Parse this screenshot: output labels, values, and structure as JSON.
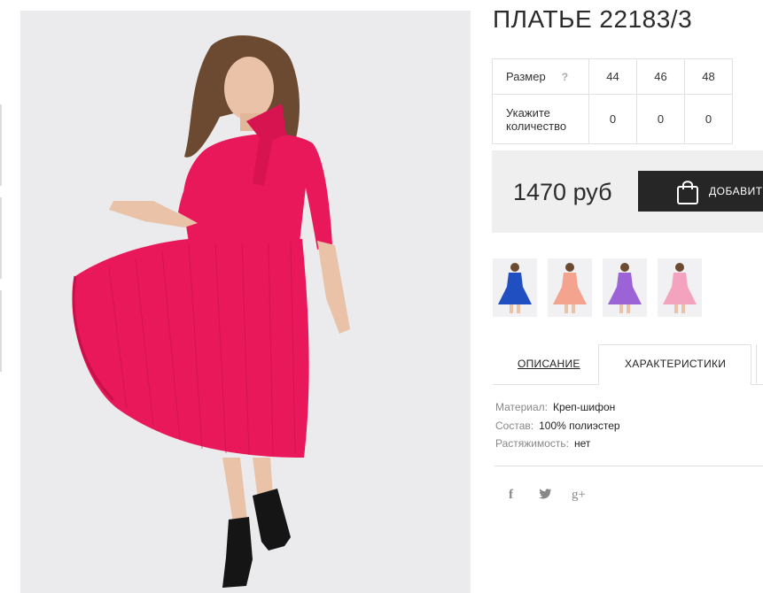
{
  "product": {
    "title": "ПЛАТЬЕ 22183/3",
    "price": "1470 руб",
    "add_to_cart_label": "ДОБАВИТ"
  },
  "size_table": {
    "size_label": "Размер",
    "help_mark": "?",
    "sizes": [
      "44",
      "46",
      "48"
    ],
    "qty_label_line1": "Укажите",
    "qty_label_line2": "количество",
    "quantities": [
      "0",
      "0",
      "0"
    ]
  },
  "variants": [
    {
      "color": "#1f4fc1"
    },
    {
      "color": "#f3a38e"
    },
    {
      "color": "#9b63d6"
    },
    {
      "color": "#f4a3bf"
    }
  ],
  "tabs": {
    "description": "ОПИСАНИЕ",
    "characteristics": "ХАРАКТЕРИСТИКИ"
  },
  "specs": [
    {
      "key": "Материал:",
      "value": "Креп-шифон"
    },
    {
      "key": "Состав:",
      "value": "100% полиэстер"
    },
    {
      "key": "Растяжимость:",
      "value": "нет"
    }
  ],
  "social": {
    "facebook": "f",
    "twitter": "t",
    "google_plus": "g+"
  },
  "colors": {
    "dress": "#e8185a",
    "button_bg": "#262626",
    "price_bg": "#efefef"
  }
}
